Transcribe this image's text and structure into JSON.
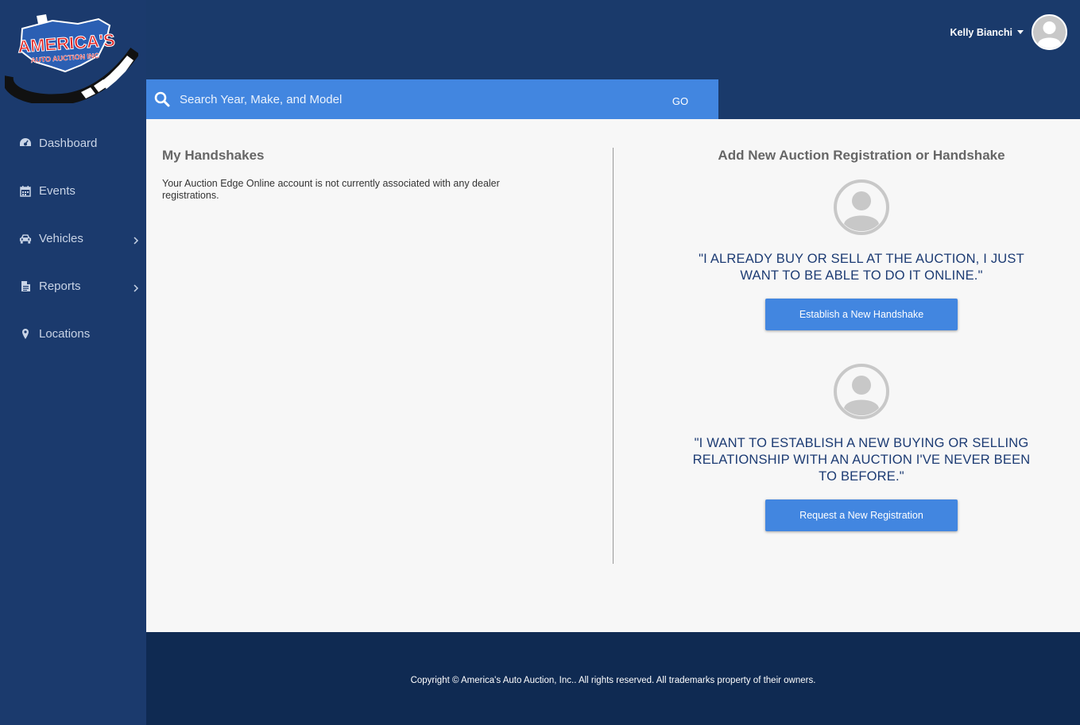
{
  "brand": {
    "logo_text_main": "AMERICA'S",
    "logo_text_sub": "AUTO AUCTION INC"
  },
  "user": {
    "name": "Kelly Bianchi"
  },
  "search": {
    "placeholder": "Search Year, Make, and Model",
    "go_label": "GO"
  },
  "sidebar": {
    "items": [
      {
        "label": "Dashboard",
        "icon": "dashboard-icon"
      },
      {
        "label": "Events",
        "icon": "calendar-icon"
      },
      {
        "label": "Vehicles",
        "icon": "car-icon"
      },
      {
        "label": "Reports",
        "icon": "document-icon"
      },
      {
        "label": "Locations",
        "icon": "map-pin-icon"
      }
    ]
  },
  "main": {
    "my_handshakes": {
      "title": "My Handshakes",
      "text": "Your Auction Edge Online account is not currently associated with any dealer registrations."
    },
    "add_new": {
      "title": "Add New Auction Registration or Handshake",
      "option1": {
        "quote": "\"I ALREADY BUY OR SELL AT THE AUCTION, I JUST WANT TO BE ABLE TO DO IT ONLINE.\"",
        "button": "Establish a New Handshake"
      },
      "option2": {
        "quote": "\"I WANT TO ESTABLISH A NEW BUYING OR SELLING RELATIONSHIP WITH AN AUCTION I'VE NEVER BEEN TO BEFORE.\"",
        "button": "Request a New Registration"
      }
    }
  },
  "footer": {
    "copyright": "Copyright © America's Auto Auction, Inc.. All rights reserved. All trademarks property of their owners."
  },
  "colors": {
    "header_bg": "#1a3a6b",
    "sidebar_bg": "#1b3a6d",
    "accent_blue": "#4286e0",
    "footer_bg": "#0f2a52",
    "quote_text": "#1c3b73"
  }
}
